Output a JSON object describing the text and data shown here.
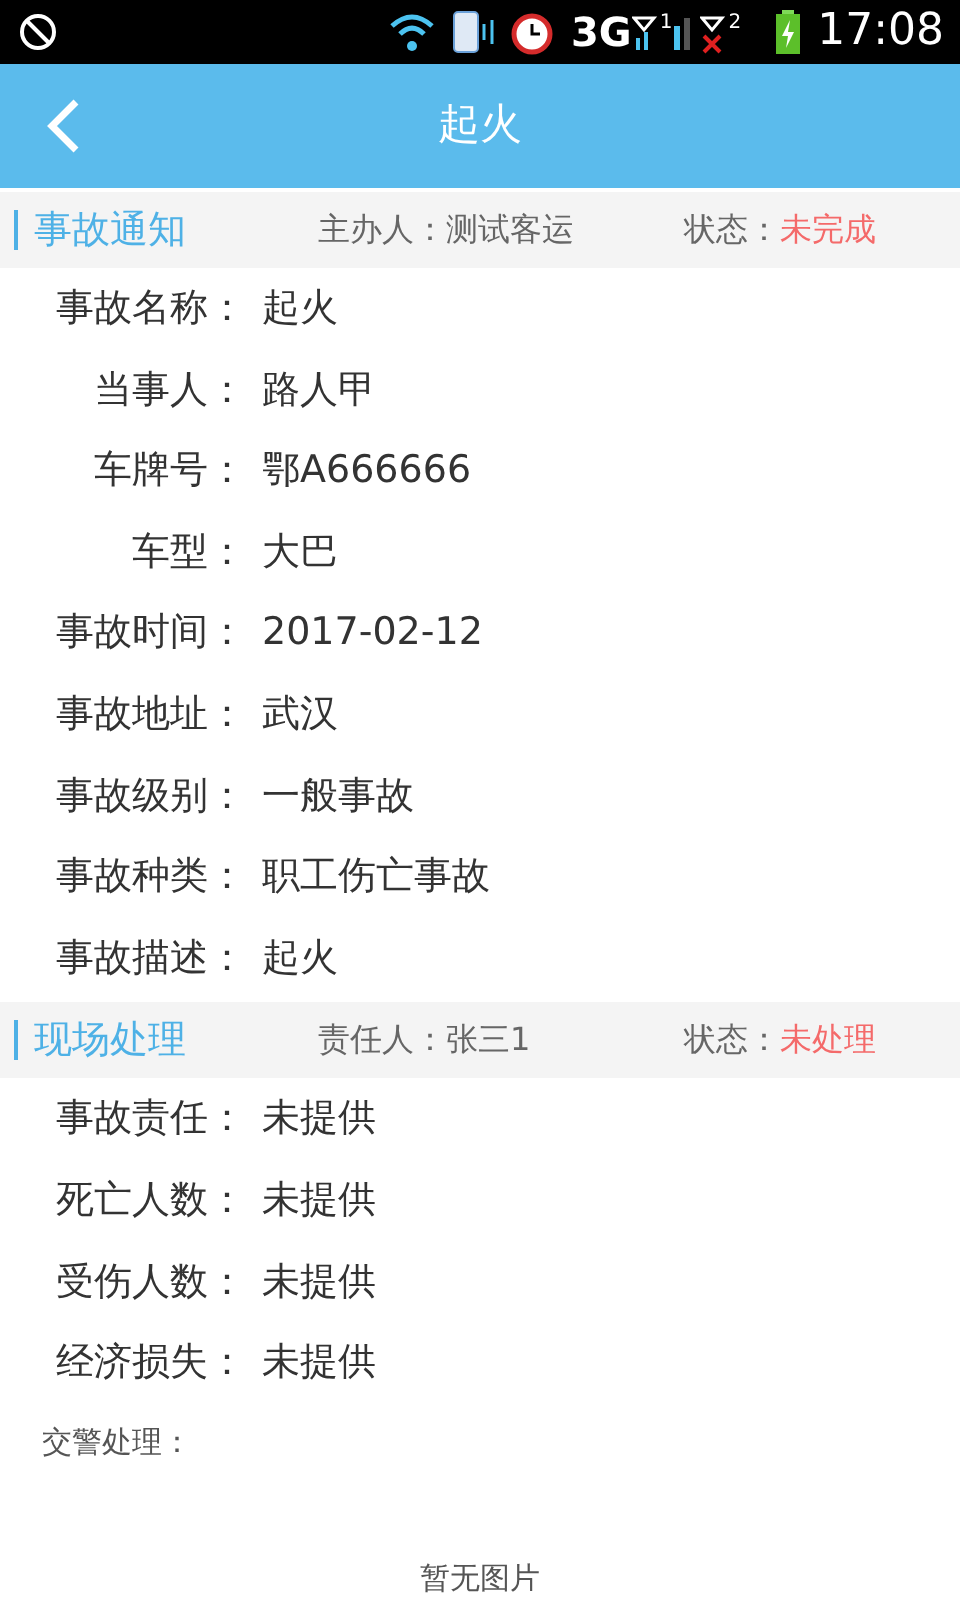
{
  "status_bar": {
    "network": "3G",
    "sim_labels": [
      "1",
      "2"
    ],
    "time": "17:08"
  },
  "header": {
    "title": "起火"
  },
  "sections": [
    {
      "title": "事故通知",
      "person_label": "主办人：",
      "person": "测试客运",
      "status_label": "状态：",
      "status": "未完成",
      "fields": [
        {
          "label": "事故名称：",
          "value": "起火"
        },
        {
          "label": "当事人：",
          "value": "路人甲"
        },
        {
          "label": "车牌号：",
          "value": "鄂A666666"
        },
        {
          "label": "车型：",
          "value": "大巴"
        },
        {
          "label": "事故时间：",
          "value": "2017-02-12"
        },
        {
          "label": "事故地址：",
          "value": "武汉"
        },
        {
          "label": "事故级别：",
          "value": "一般事故"
        },
        {
          "label": "事故种类：",
          "value": "职工伤亡事故"
        },
        {
          "label": "事故描述：",
          "value": "起火"
        }
      ]
    },
    {
      "title": "现场处理",
      "person_label": "责任人：",
      "person": "张三1",
      "status_label": "状态：",
      "status": "未处理",
      "fields": [
        {
          "label": "事故责任：",
          "value": "未提供"
        },
        {
          "label": "死亡人数：",
          "value": "未提供"
        },
        {
          "label": "受伤人数：",
          "value": "未提供"
        },
        {
          "label": "经济损失：",
          "value": "未提供"
        }
      ]
    }
  ],
  "police": {
    "label": "交警处理：",
    "empty_text": "暂无图片"
  }
}
